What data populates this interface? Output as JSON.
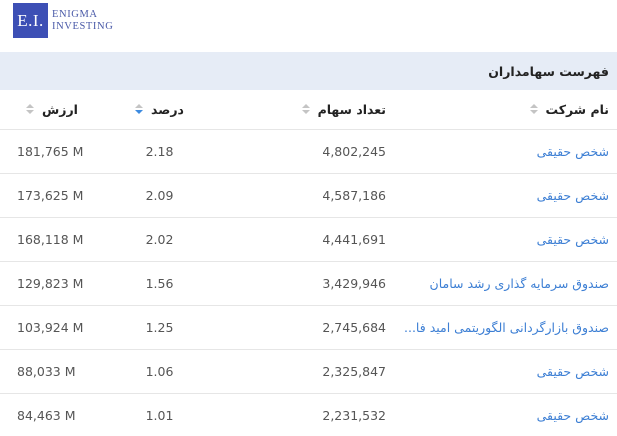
{
  "logo": {
    "badge": "E.I.",
    "line1": "ENIGMA",
    "line2": "INVESTING"
  },
  "section": {
    "title": "فهرست سهامداران"
  },
  "table": {
    "headers": {
      "name": "نام شرکت",
      "shares": "تعداد سهام",
      "percent": "درصد",
      "value": "ارزش"
    },
    "sorted_column": "percent",
    "sort_direction": "descending",
    "rows": [
      {
        "name": "شخص حقیقی",
        "shares": "4,802,245",
        "percent": "2.18",
        "value": "181,765 M"
      },
      {
        "name": "شخص حقیقی",
        "shares": "4,587,186",
        "percent": "2.09",
        "value": "173,625 M"
      },
      {
        "name": "شخص حقیقی",
        "shares": "4,441,691",
        "percent": "2.02",
        "value": "168,118 M"
      },
      {
        "name": "صندوق سرمایه گذاری رشد سامان",
        "shares": "3,429,946",
        "percent": "1.56",
        "value": "129,823 M"
      },
      {
        "name": "صندوق بازارگردانی الگوریتمی امید فا...",
        "shares": "2,745,684",
        "percent": "1.25",
        "value": "103,924 M"
      },
      {
        "name": "شخص حقیقی",
        "shares": "2,325,847",
        "percent": "1.06",
        "value": "88,033 M"
      },
      {
        "name": "شخص حقیقی",
        "shares": "2,231,532",
        "percent": "1.01",
        "value": "84,463 M"
      }
    ]
  },
  "colors": {
    "accent": "#3d7fd4",
    "header_bg": "#e6ecf6",
    "logo_bg": "#3d4fb5"
  }
}
